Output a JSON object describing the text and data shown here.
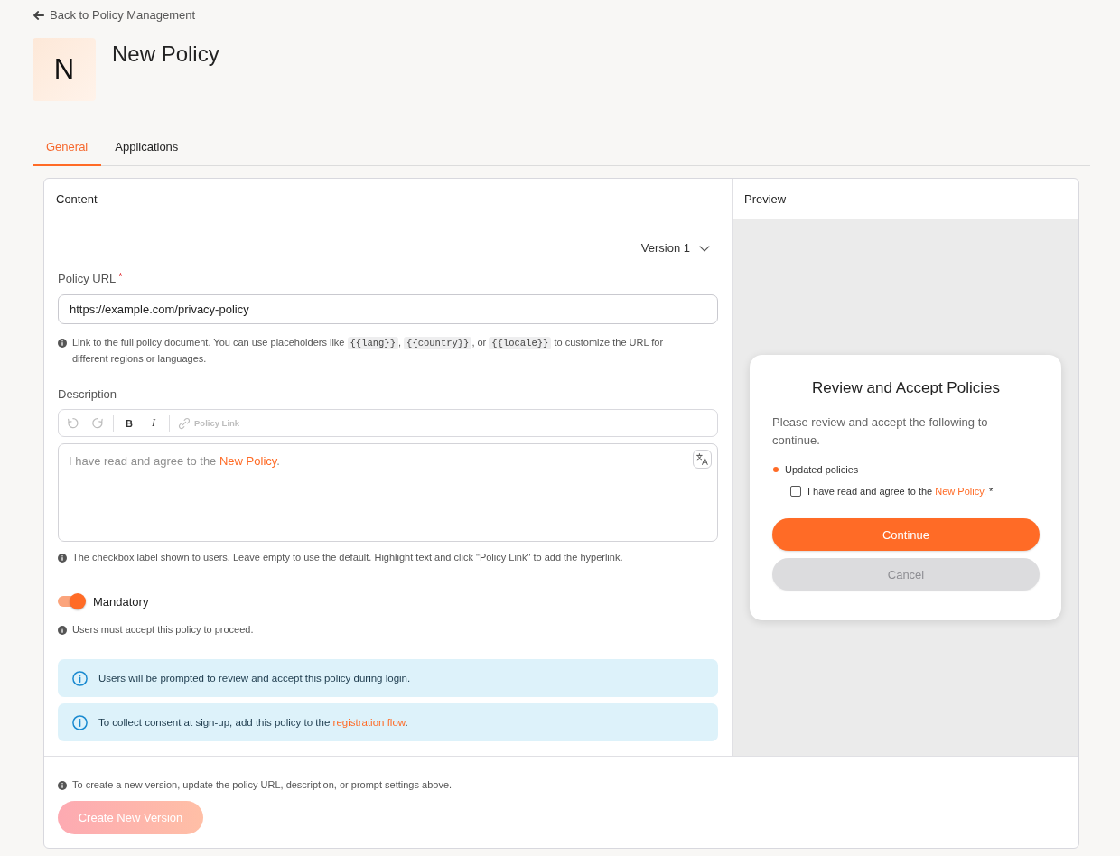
{
  "back_link": {
    "label": "Back to Policy Management"
  },
  "policy": {
    "avatar_letter": "N",
    "title": "New Policy"
  },
  "tabs": [
    {
      "label": "General",
      "selected": true
    },
    {
      "label": "Applications",
      "selected": false
    }
  ],
  "content_panel": {
    "heading": "Content",
    "version_select": {
      "value": "Version 1"
    },
    "policy_url": {
      "label": "Policy URL",
      "required_mark": "*",
      "value": "https://example.com/privacy-policy",
      "hint": [
        {
          "kind": "text",
          "text": "Link to the full policy document. You can use placeholders like "
        },
        {
          "kind": "code",
          "text": "{{lang}}"
        },
        {
          "kind": "text",
          "text": ", "
        },
        {
          "kind": "code",
          "text": "{{country}}"
        },
        {
          "kind": "text",
          "text": ", or "
        },
        {
          "kind": "code",
          "text": "{{locale}}"
        },
        {
          "kind": "text",
          "text": " to customize the URL for different regions or languages."
        }
      ]
    },
    "description": {
      "label": "Description",
      "toolbar": [
        {
          "kind": "undo",
          "disabled": true
        },
        {
          "kind": "redo",
          "disabled": true
        },
        {
          "kind": "bold",
          "label": "B",
          "disabled": false
        },
        {
          "kind": "italic",
          "label": "I",
          "disabled": false
        },
        {
          "kind": "link",
          "label": "Policy Link",
          "disabled": true
        }
      ],
      "value": [
        {
          "kind": "text",
          "text": "I have read and agree to the "
        },
        {
          "kind": "link",
          "text": "New Policy"
        },
        {
          "kind": "text",
          "text": "."
        }
      ],
      "hint": "The checkbox label shown to users. Leave empty to use the default. Highlight text and click \"Policy Link\" to add the hyperlink."
    },
    "mandatory": {
      "label": "Mandatory",
      "on": true,
      "hint": "Users must accept this policy to proceed."
    },
    "notices": [
      {
        "text": [
          {
            "kind": "text",
            "text": "Users will be prompted to review and accept this policy during login."
          }
        ]
      },
      {
        "text": [
          {
            "kind": "text",
            "text": "To collect consent at sign-up, add this policy to the "
          },
          {
            "kind": "link",
            "text": "registration flow"
          },
          {
            "kind": "text",
            "text": "."
          }
        ]
      }
    ]
  },
  "footer": {
    "hint": "To create a new version, update the policy URL, description, or prompt settings above.",
    "button": {
      "label": "Create New Version",
      "disabled": true
    }
  },
  "preview_panel": {
    "heading": "Preview",
    "dialog": {
      "title": "Review and Accept Policies",
      "message": "Please review and accept the following to continue.",
      "section": "Updated policies",
      "policies": [
        {
          "checked": false,
          "text": [
            {
              "kind": "text",
              "text": "I have read and agree to the "
            },
            {
              "kind": "link",
              "text": "New Policy"
            },
            {
              "kind": "text",
              "text": "."
            }
          ],
          "required_mark": "*"
        }
      ],
      "buttons": [
        {
          "label": "Continue",
          "disabled": false
        },
        {
          "label": "Cancel",
          "disabled": true
        }
      ]
    }
  }
}
